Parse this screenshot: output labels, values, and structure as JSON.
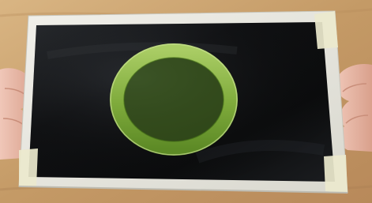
{
  "scene": {
    "subject": "lcd-panel",
    "overlay_icon": "green-ring-icon",
    "colors": {
      "table": "#c9a16f",
      "bezel": "#e7e5dc",
      "screen": "#0f1012",
      "ring": "#7eaa3b",
      "ring_highlight": "#b8d67a",
      "tape": "#e9e6c6",
      "skin": "#e8b9a9"
    }
  }
}
